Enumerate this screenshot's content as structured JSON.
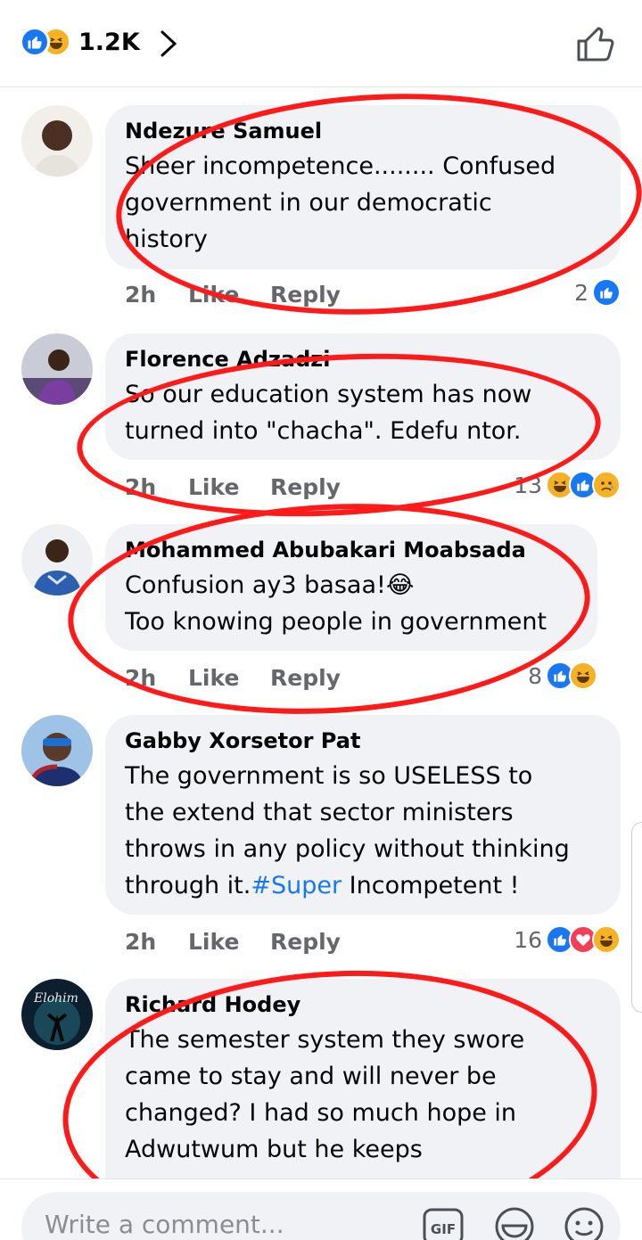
{
  "header": {
    "reaction_count": "1.2K",
    "reaction_icons": [
      "like-icon",
      "haha-icon"
    ],
    "chevron_icon": "chevron-right-icon",
    "like_button_icon": "thumbs-up-icon"
  },
  "colors": {
    "accent": "#1877f2",
    "bubble": "#f0f2f5",
    "muted": "#65676b",
    "annotation": "#ff1a1a"
  },
  "comments": [
    {
      "author": "Ndezure Samuel",
      "lines": [
        "Sheer incompetence........ Confused",
        "government in our democratic",
        "history"
      ],
      "time": "2h",
      "like": "Like",
      "reply": "Reply",
      "reaction_count": "2",
      "reactions": [
        "like-icon"
      ]
    },
    {
      "author": "Florence Adzadzi",
      "lines": [
        "So our education system has now",
        "turned into \"chacha\". Edefu ntor."
      ],
      "time": "2h",
      "like": "Like",
      "reply": "Reply",
      "reaction_count": "13",
      "reactions": [
        "haha-icon",
        "like-icon",
        "sad-icon"
      ]
    },
    {
      "author": "Mohammed Abubakari Moabsada",
      "lines": [
        "Confusion ay3 basaa!😂",
        "Too knowing people in government"
      ],
      "time": "2h",
      "like": "Like",
      "reply": "Reply",
      "reaction_count": "8",
      "reactions": [
        "like-icon",
        "haha-icon"
      ]
    },
    {
      "author": "Gabby Xorsetor Pat",
      "lines": [
        "The government is so USELESS to",
        "the extend that sector ministers",
        "throws in any policy without thinking"
      ],
      "last_line_prefix": "through it.",
      "hashtag": "#Super",
      "last_line_suffix": " Incompetent !",
      "time": "2h",
      "like": "Like",
      "reply": "Reply",
      "reaction_count": "16",
      "reactions": [
        "like-icon",
        "love-icon",
        "haha-icon"
      ]
    },
    {
      "author": "Richard Hodey",
      "lines": [
        "The semester system they swore",
        "came to stay and will never be",
        "changed? I had so much hope in",
        "Adwutwum but he keeps"
      ]
    }
  ],
  "footer": {
    "placeholder": "Write a comment...",
    "icons": [
      "gif-icon",
      "sticker-icon",
      "emoji-icon"
    ],
    "gif_label": "GIF"
  }
}
